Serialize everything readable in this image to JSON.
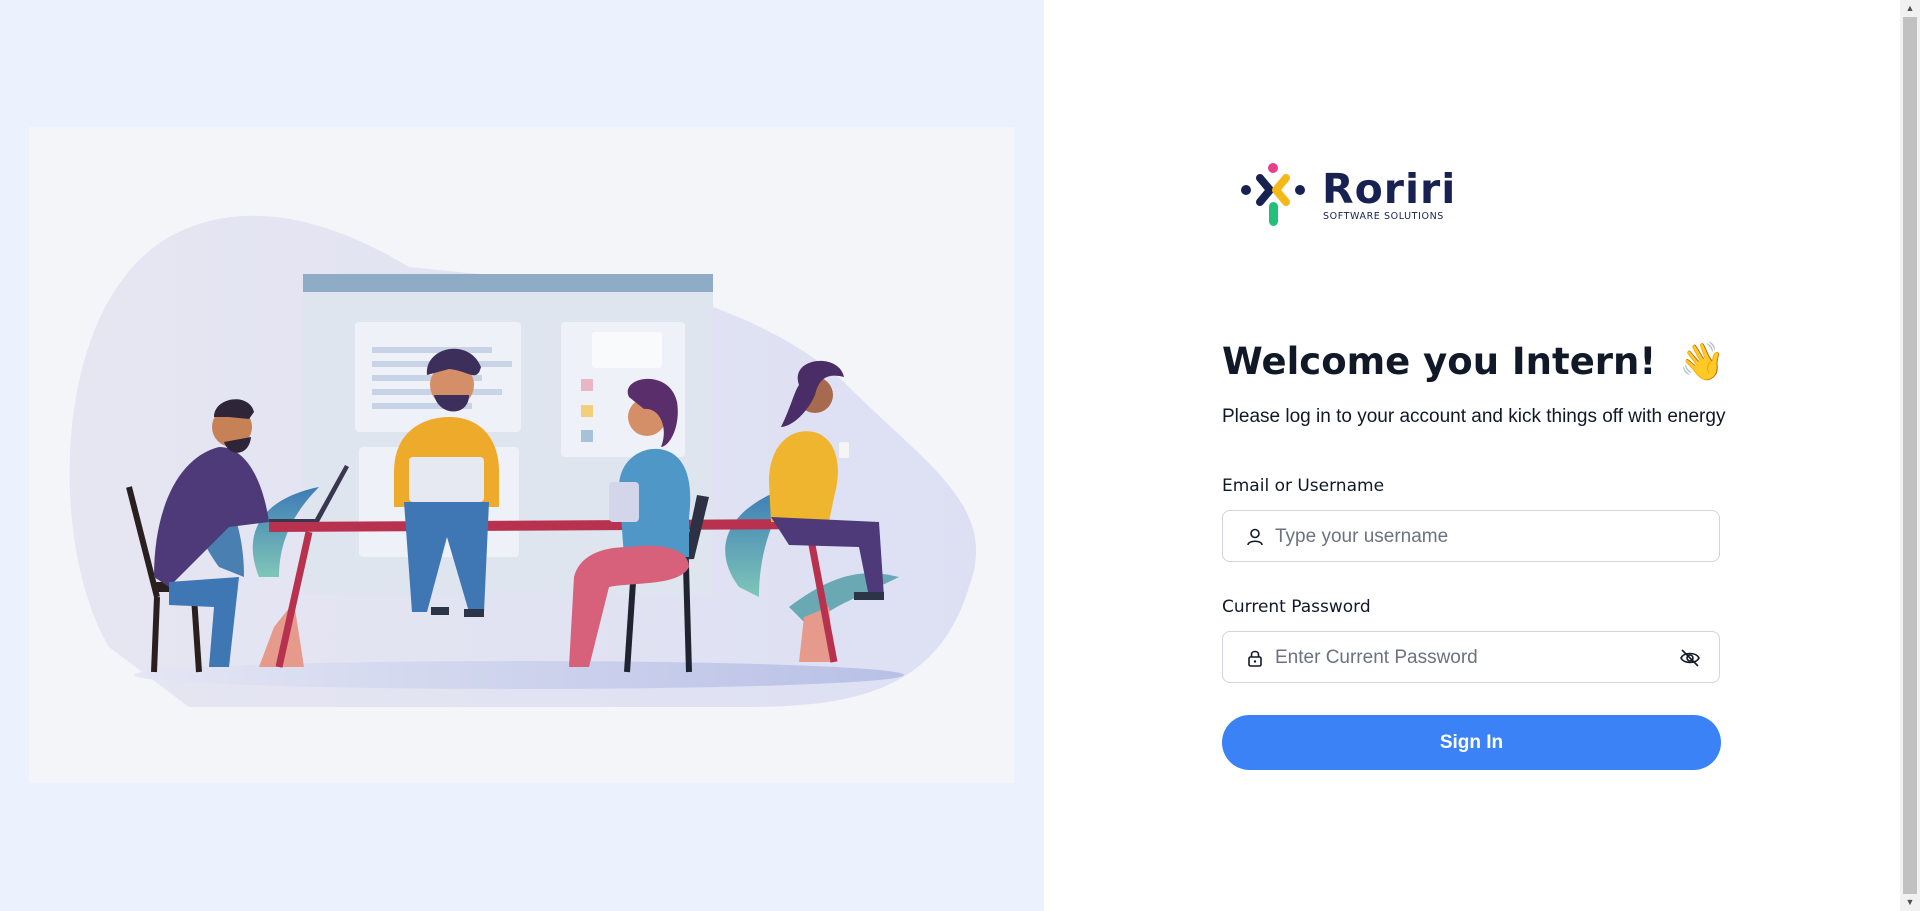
{
  "brand": {
    "name": "Roriri",
    "tagline": "SOFTWARE SOLUTIONS",
    "colors": {
      "navy": "#172253",
      "pink": "#e83e8c",
      "yellow": "#f5b819",
      "green": "#22c07a",
      "primary": "#3b82f6"
    }
  },
  "illustration": {
    "icon": "team-working-illustration"
  },
  "welcome": {
    "title": "Welcome you Intern!",
    "emoji": "👋",
    "subtitle": "Please log in to your account and kick things off with energy"
  },
  "form": {
    "username": {
      "label": "Email or Username",
      "placeholder": "Type your username",
      "value": "",
      "icon": "user-icon"
    },
    "password": {
      "label": "Current Password",
      "placeholder": "Enter Current Password",
      "value": "",
      "icon": "lock-icon",
      "toggle_icon": "eye-off-icon"
    },
    "submit_label": "Sign In"
  }
}
